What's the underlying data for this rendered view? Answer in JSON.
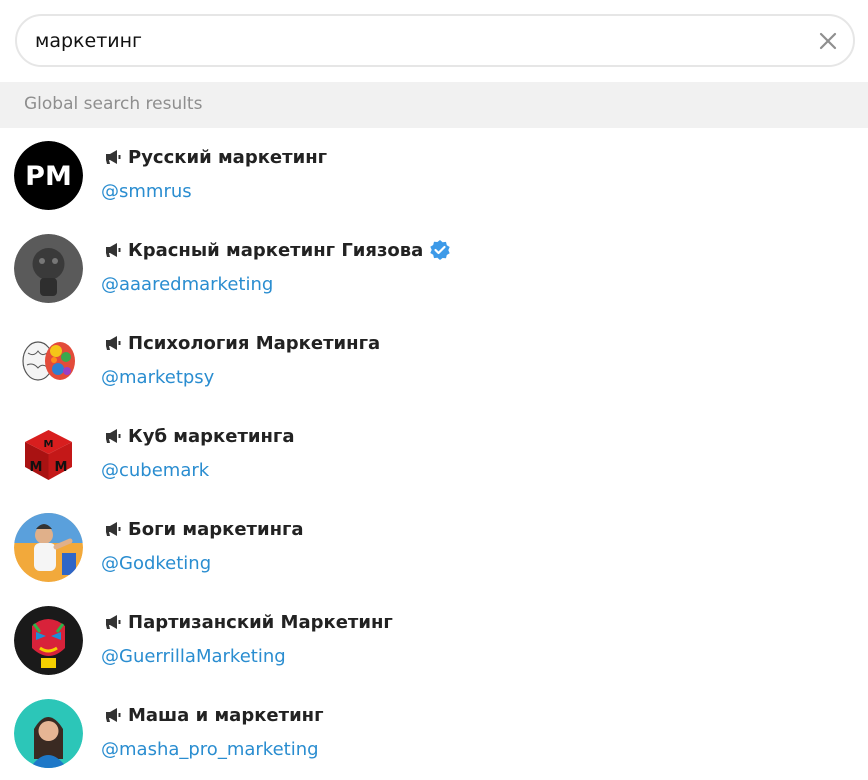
{
  "search": {
    "value": "маркетинг",
    "clear_icon": "close-icon"
  },
  "section": {
    "label": "Global search results"
  },
  "results": [
    {
      "name": "Русский маркетинг",
      "username": "@smmrus",
      "verified": false,
      "avatar_text": "PM",
      "type_icon": "megaphone-icon"
    },
    {
      "name": "Красный маркетинг Гиязова",
      "username": "@aaaredmarketing",
      "verified": true,
      "type_icon": "megaphone-icon"
    },
    {
      "name": "Психология Маркетинга",
      "username": "@marketpsy",
      "verified": false,
      "type_icon": "megaphone-icon"
    },
    {
      "name": "Куб маркетинга",
      "username": "@cubemark",
      "verified": false,
      "type_icon": "megaphone-icon"
    },
    {
      "name": "Боги маркетинга",
      "username": "@Godketing",
      "verified": false,
      "type_icon": "megaphone-icon"
    },
    {
      "name": "Партизанский Маркетинг",
      "username": "@GuerrillaMarketing",
      "verified": false,
      "type_icon": "megaphone-icon"
    },
    {
      "name": "Маша и маркетинг",
      "username": "@masha_pro_marketing",
      "verified": false,
      "type_icon": "megaphone-icon"
    }
  ],
  "colors": {
    "link": "#2a8dd0",
    "verified": "#3d9ae8",
    "header_bg": "#f1f1f1"
  }
}
